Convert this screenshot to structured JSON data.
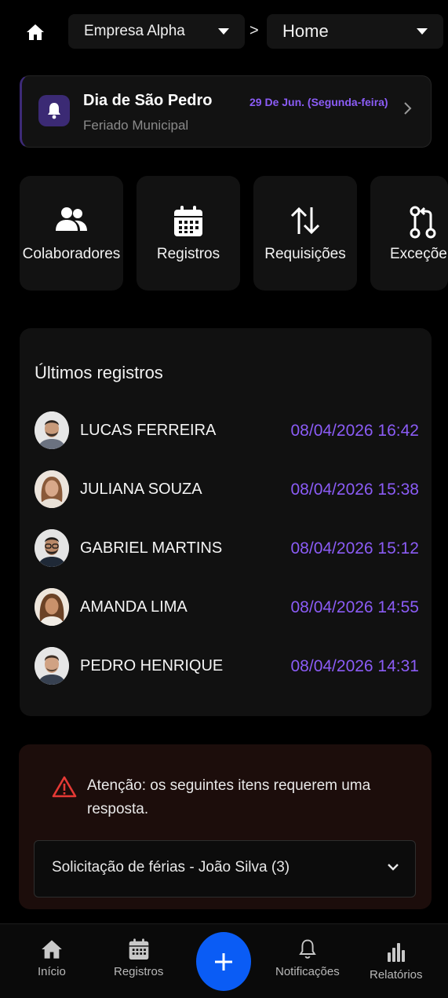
{
  "header": {
    "company_select": "Empresa Alpha",
    "breadcrumb_sep": ">",
    "page_select": "Home"
  },
  "holiday": {
    "title": "Dia de São Pedro",
    "subtitle": "Feriado Municipal",
    "date": "29 De Jun. (Segunda-feira)"
  },
  "tiles": [
    {
      "label": "Colaboradores",
      "icon": "users-icon"
    },
    {
      "label": "Registros",
      "icon": "calendar-icon"
    },
    {
      "label": "Requisições",
      "icon": "arrows-up-down-icon"
    },
    {
      "label": "Exceçõe",
      "icon": "git-pull-request-icon"
    }
  ],
  "records": {
    "title": "Últimos registros",
    "rows": [
      {
        "name": "LUCAS FERREIRA",
        "time": "08/04/2026 16:42"
      },
      {
        "name": "JULIANA SOUZA",
        "time": "08/04/2026 15:38"
      },
      {
        "name": "GABRIEL MARTINS",
        "time": "08/04/2026 15:12"
      },
      {
        "name": "AMANDA LIMA",
        "time": "08/04/2026 14:55"
      },
      {
        "name": "PEDRO HENRIQUE",
        "time": "08/04/2026 14:31"
      }
    ]
  },
  "alert": {
    "text": "Atenção: os seguintes itens requerem uma resposta.",
    "select_value": "Solicitação de férias - João Silva (3)"
  },
  "nav": {
    "inicio": "Início",
    "registros": "Registros",
    "notificacoes": "Notificações",
    "relatorios": "Relatórios"
  },
  "colors": {
    "accent": "#8b5cf6",
    "fab": "#0a5cf5",
    "alert_bg": "#1c0d0b",
    "alert_icon": "#e53935"
  }
}
